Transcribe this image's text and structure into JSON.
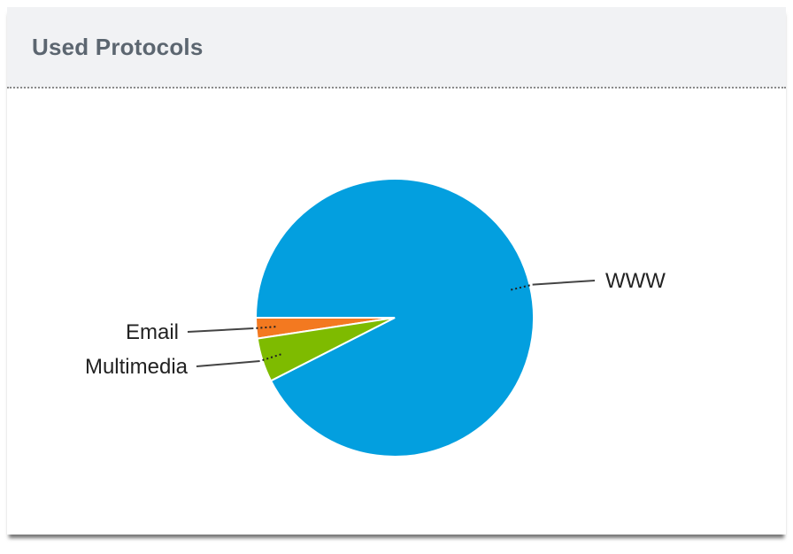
{
  "widget": {
    "title": "Used Protocols"
  },
  "chart_data": {
    "type": "pie",
    "title": "Used Protocols",
    "slices": [
      {
        "label": "WWW",
        "value": 92.5,
        "color": "#039fdf"
      },
      {
        "label": "Email",
        "value": 2.4,
        "color": "#f37920"
      },
      {
        "label": "Multimedia",
        "value": 5.1,
        "color": "#7ebb00"
      }
    ],
    "legend": "none",
    "label_style": "leader-lines"
  }
}
